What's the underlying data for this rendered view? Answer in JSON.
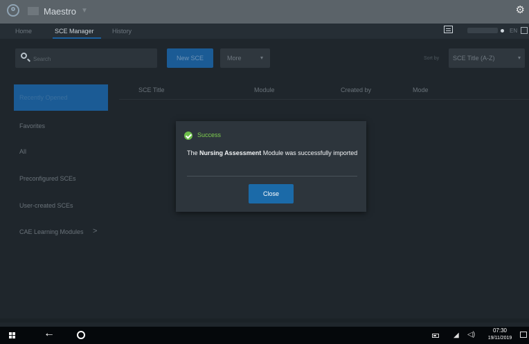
{
  "app": {
    "name": "Maestro",
    "caret": "▼"
  },
  "menu": {
    "items": [
      "Home",
      "SCE Manager",
      "History"
    ],
    "active": "SCE Manager",
    "language": "EN"
  },
  "toolbar": {
    "search_placeholder": "Search",
    "new_sce_label": "New SCE",
    "more_label": "More",
    "sort_label": "Sort by",
    "sort_value": "SCE Title (A-Z)",
    "caret": "▾"
  },
  "sidebar": {
    "active_item": "Recently Opened",
    "items": [
      "Favorites",
      "All",
      "Preconfigured SCEs",
      "User-created SCEs",
      "CAE Learning Modules"
    ],
    "arrow": ">"
  },
  "table": {
    "headers": [
      "SCE Title",
      "Module",
      "Created by",
      "Mode"
    ]
  },
  "modal": {
    "status": "Success",
    "message_prefix": "The ",
    "module_name": "Nursing Assessment",
    "message_suffix": " Module was successfully imported",
    "close_label": "Close"
  },
  "taskbar": {
    "time": "07:30",
    "date": "19/11/2019"
  },
  "colors": {
    "accent": "#1b5b95",
    "success": "#6dbe4b",
    "background": "#1f262c"
  }
}
